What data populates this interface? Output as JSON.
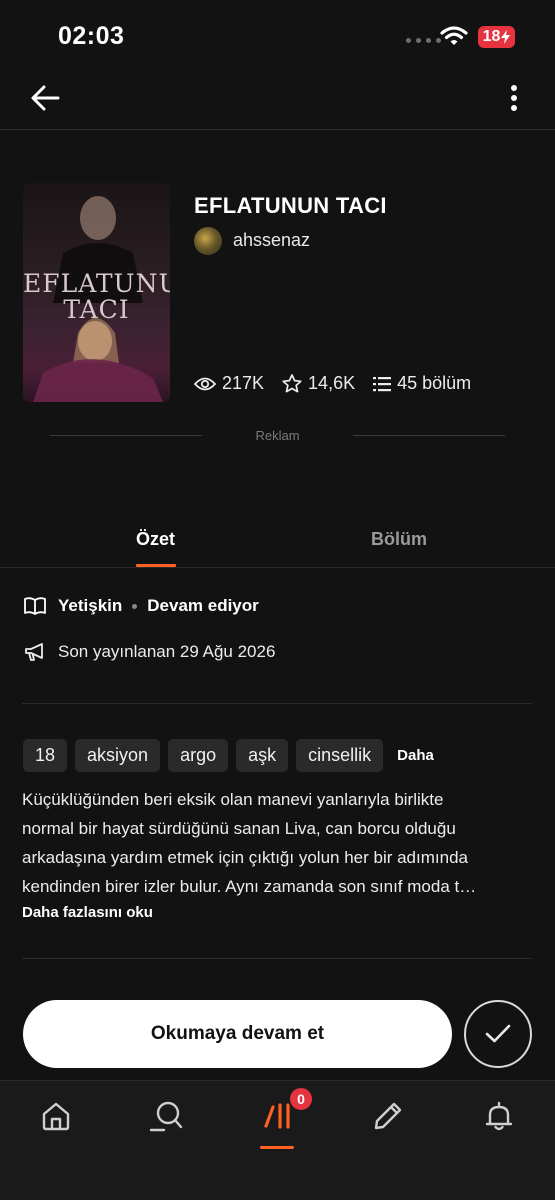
{
  "status_bar": {
    "time": "02:03",
    "battery": "18"
  },
  "book": {
    "title": "EFLATUNUN TACI",
    "cover_text": "EFLATUNUN TACI",
    "author": "ahssenaz",
    "views": "217K",
    "votes": "14,6K",
    "parts": "45 bölüm"
  },
  "ad": {
    "label": "Reklam"
  },
  "tabs": [
    {
      "label": "Özet",
      "active": true
    },
    {
      "label": "Bölüm",
      "active": false
    }
  ],
  "info": {
    "rating": "Yetişkin",
    "status": "Devam ediyor",
    "last_published": "Son yayınlanan 29 Ağu 2026"
  },
  "tags": [
    "18",
    "aksiyon",
    "argo",
    "aşk",
    "cinsellik"
  ],
  "tags_more": "Daha",
  "description_lines": [
    "Küçüklüğünden beri eksik olan manevi yanlarıyla birlikte",
    "normal bir hayat sürdüğünü sanan Liva, can borcu olduğu",
    "arkadaşına yardım etmek için çıktığı yolun her bir adımında",
    "kendinden birer izler bulur. Aynı zamanda son sınıf moda t…"
  ],
  "read_more": "Daha fazlasını oku",
  "cta": {
    "continue_label": "Okumaya devam et"
  },
  "bottom_nav": {
    "library_badge": "0"
  },
  "colors": {
    "accent": "#ff6122",
    "background": "#121212",
    "badge": "#e5343f"
  }
}
